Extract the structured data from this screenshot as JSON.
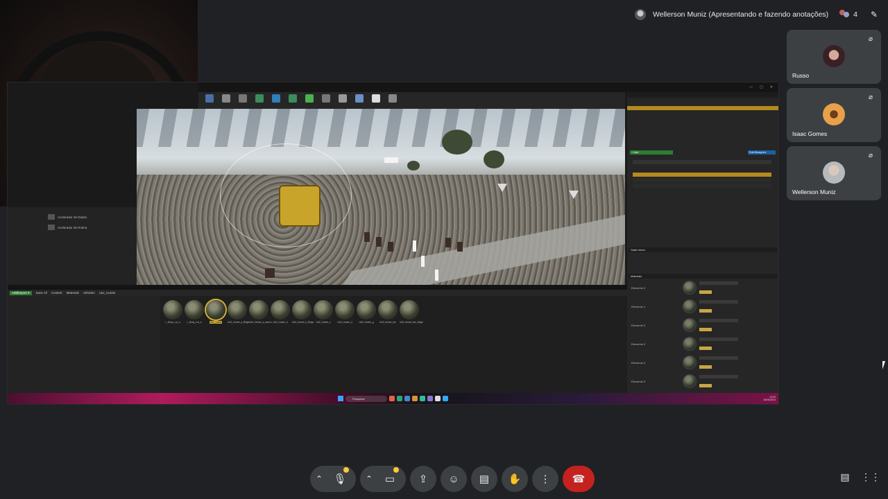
{
  "presenter": {
    "label": "Wellerson Muniz (Apresentando e fazendo anotações)",
    "participant_count": "4"
  },
  "participants": [
    {
      "name": "Russo"
    },
    {
      "name": "Isaac Gomes"
    },
    {
      "name": "Wellerson Muniz"
    }
  ],
  "shared_screen": {
    "left_panel_items": [
      "Acelerador de Dados",
      "Acelerador de Rotina"
    ],
    "details_tab": "BP_SPPDVehicle_UAZ_Hunter",
    "edit_blueprint": "Edit Blueprint",
    "add_component": "+ Add",
    "sections": [
      "Static Mesh",
      "Materials",
      "Physics"
    ],
    "material_slots": [
      "Elemento 0",
      "Elemento 1",
      "Elemento 2",
      "Elemento 3",
      "Elemento 4",
      "Elemento 5"
    ],
    "content_browser": {
      "add_button": "Add/Import ▾",
      "save_all": "Save All",
      "breadcrumb": [
        "Content",
        "Materials",
        "Vehicles",
        "Uaz_Hunter"
      ],
      "assets": [
        "L_Body_Lux_a",
        "L_Body_Lux_b",
        "UAZ_Hunter",
        "UAZ_Hunter_a_Beige",
        "UAZ_Hunter_a_camou",
        "UAZ_Hunter_b",
        "UAZ_Hunter_b_Beige",
        "UAZ_Hunter_c",
        "UAZ_Hunter_d",
        "UAZ_Hunter_g",
        "UAZ_Hunter_tire",
        "UAZ_Hunter_tire_Beige"
      ],
      "selected_asset_index": 2
    },
    "taskbar_search": "Pesquisar",
    "taskbar_time": "14:03",
    "taskbar_date": "26/06/2024"
  },
  "controls": {
    "mic_icon": "mic-icon",
    "camera_icon": "camera-icon",
    "present_icon": "present-screen-icon",
    "emoji_icon": "emoji-icon",
    "captions_icon": "captions-icon",
    "raise_hand_icon": "raise-hand-icon",
    "more_icon": "more-options-icon",
    "end_call_icon": "end-call-icon",
    "chat_icon": "chat-icon",
    "activities_icon": "activities-icon"
  },
  "colors": {
    "meet_bg": "#202124",
    "tile_bg": "#3c4043",
    "end_call": "#c5221f",
    "notify_dot": "#fcc934",
    "ue_selection": "#b48a1f"
  }
}
